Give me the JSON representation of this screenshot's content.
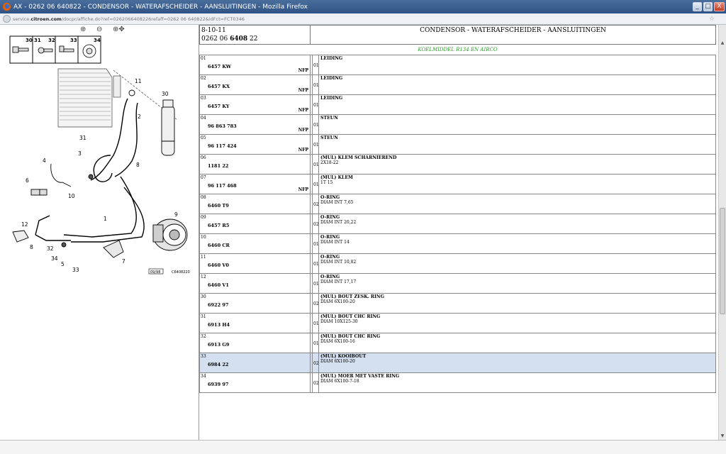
{
  "window": {
    "title": "AX - 0262 06 640822 - CONDENSOR - WATERAFSCHEIDER - AANSLUITINGEN - Mozilla Firefox",
    "minimize": "_",
    "maximize": "□",
    "close": "X"
  },
  "address": {
    "prefix": "service.",
    "domain": "citroen.com",
    "rest": "/docpr/affiche.do?ref=0262066408226refaff=0262 06 640822&idFct=FCT0346"
  },
  "toolbar": {
    "zoom_in": "⊕",
    "zoom_out": "⊖",
    "zoom_pan": "⊕✥"
  },
  "diagram": {
    "inset_numbers": [
      "30",
      "31",
      "32",
      "33",
      "34"
    ],
    "callouts": [
      "11",
      "30",
      "2",
      "31",
      "3",
      "4",
      "6",
      "8",
      "10",
      "9",
      "12",
      "8",
      "32",
      "1",
      "34",
      "5",
      "7",
      "33"
    ],
    "date_code": "09/98",
    "ref_code": "C6408220"
  },
  "header": {
    "date": "8-10-11",
    "ref_prefix": "0262 06",
    "ref_bold": "6408",
    "ref_suffix": "22",
    "title": "CONDENSOR - WATERAFSCHEIDER - AANSLUITINGEN",
    "subtitle": "KOELMIDDEL R134 EN AIRCO"
  },
  "parts": [
    {
      "num": "01",
      "pn": "6457 KW",
      "nfp": "NFP",
      "qty": "01",
      "name": "LEIDING",
      "desc": ""
    },
    {
      "num": "02",
      "pn": "6457 KX",
      "nfp": "NFP",
      "qty": "01",
      "name": "LEIDING",
      "desc": ""
    },
    {
      "num": "03",
      "pn": "6457 KY",
      "nfp": "NFP",
      "qty": "01",
      "name": "LEIDING",
      "desc": ""
    },
    {
      "num": "04",
      "pn": "96 863 783",
      "nfp": "NFP",
      "qty": "01",
      "name": "STEUN",
      "desc": ""
    },
    {
      "num": "05",
      "pn": "96 117 424",
      "nfp": "NFP",
      "qty": "01",
      "name": "STEUN",
      "desc": ""
    },
    {
      "num": "06",
      "pn": "1181 22",
      "nfp": "",
      "qty": "01",
      "name": "(MUL) KLEM SCHARNIEREND",
      "desc": "2X18-22"
    },
    {
      "num": "07",
      "pn": "96 117 468",
      "nfp": "NFP",
      "qty": "01",
      "name": "(MUL) KLEM",
      "desc": "1T 15"
    },
    {
      "num": "08",
      "pn": "6460 T9",
      "nfp": "",
      "qty": "02",
      "name": "O-RING",
      "desc": "DIAM INT 7,65"
    },
    {
      "num": "09",
      "pn": "6457 R5",
      "nfp": "",
      "qty": "02",
      "name": "O-RING",
      "desc": "DIAM INT 20,22"
    },
    {
      "num": "10",
      "pn": "6460 CR",
      "nfp": "",
      "qty": "01",
      "name": "O-RING",
      "desc": "DIAM INT 14"
    },
    {
      "num": "11",
      "pn": "6460 V0",
      "nfp": "",
      "qty": "01",
      "name": "O-RING",
      "desc": "DIAM INT 10,82"
    },
    {
      "num": "12",
      "pn": "6460 V1",
      "nfp": "",
      "qty": "01",
      "name": "O-RING",
      "desc": "DIAM INT 17,17"
    },
    {
      "num": "30",
      "pn": "6922 97",
      "nfp": "",
      "qty": "02",
      "name": "(MUL) BOUT ZESK. RING",
      "desc": "DIAM 6X100-20"
    },
    {
      "num": "31",
      "pn": "6913 H4",
      "nfp": "",
      "qty": "01",
      "name": "(MUL) BOUT CHC RING",
      "desc": "DIAM 10X125-30"
    },
    {
      "num": "32",
      "pn": "6913 G9",
      "nfp": "",
      "qty": "01",
      "name": "(MUL) BOUT CHC RING",
      "desc": "DIAM 6X100-16"
    },
    {
      "num": "33",
      "pn": "6984 22",
      "nfp": "",
      "qty": "02",
      "name": "(MUL) KOOIBOUT",
      "desc": "DIAM 6X100-20",
      "selected": true
    },
    {
      "num": "34",
      "pn": "6939 97",
      "nfp": "",
      "qty": "02",
      "name": "(MUL) MOER MET VASTE RING",
      "desc": "DIAM 6X100-7-18"
    }
  ],
  "scroll": {
    "up": "▲",
    "down": "▼",
    "plus": "+"
  }
}
